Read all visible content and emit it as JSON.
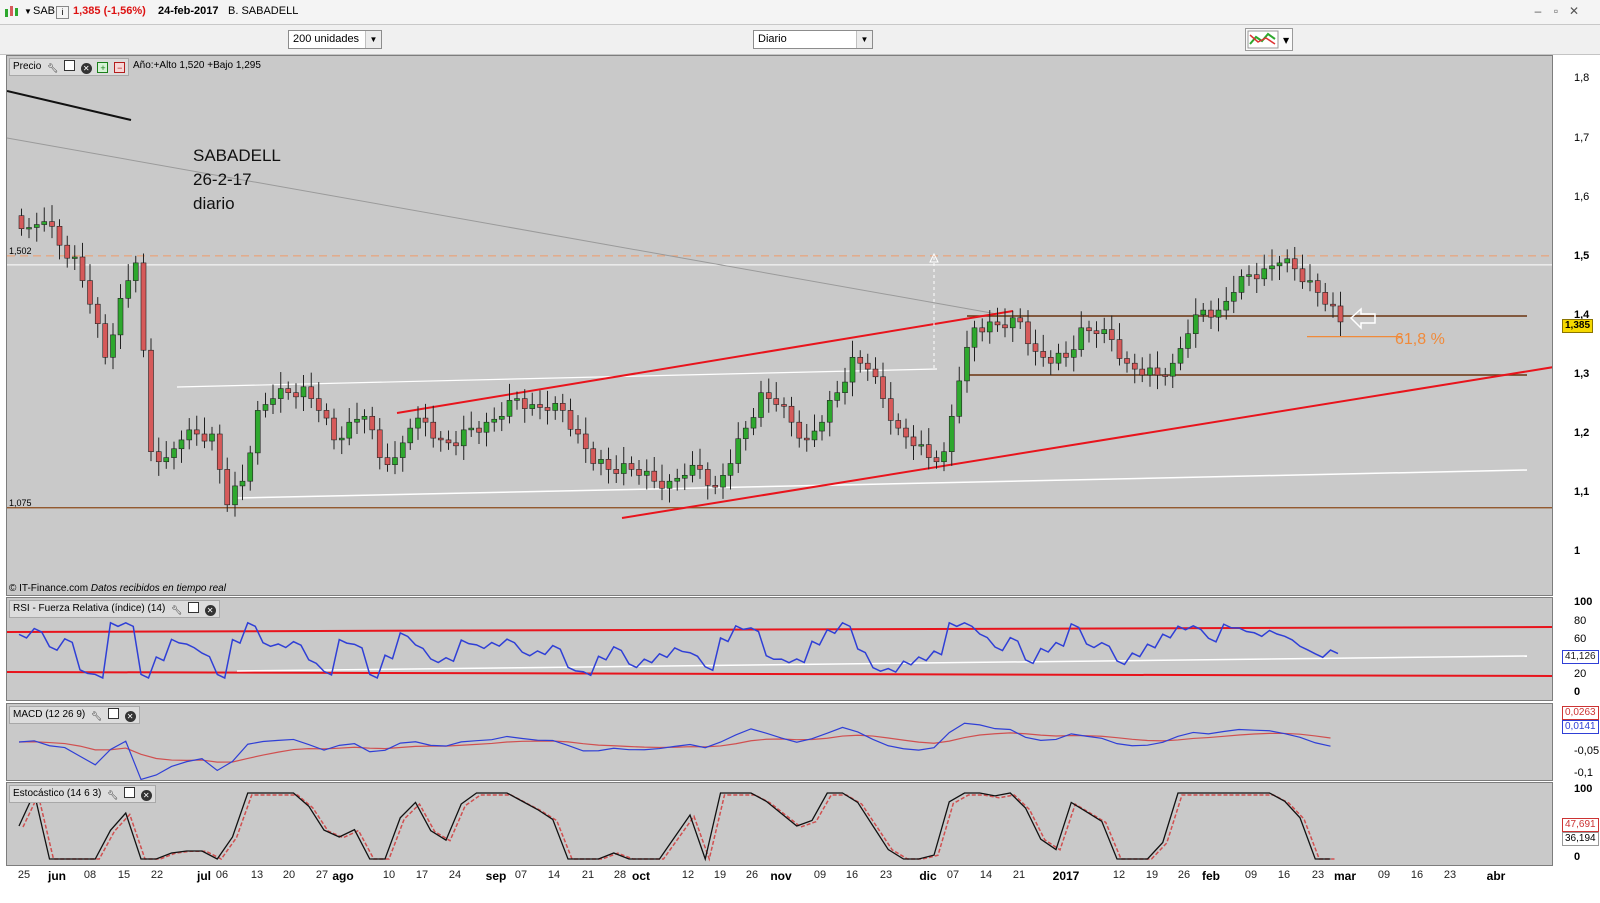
{
  "titlebar": {
    "symbol": "SAB",
    "price_change": "1,385 (-1,56%)",
    "date": "24-feb-2017",
    "name": "B. SABADELL"
  },
  "toolbar": {
    "units_select": "200 unidades",
    "period_select": "Diario"
  },
  "price_panel": {
    "header": "Precio",
    "year_info": "Año:+Alto 1,520 +Bajo 1,295",
    "notes": [
      "SABADELL",
      "26-2-17",
      "diario"
    ],
    "ref_high": "1,502",
    "ref_low": "1,075",
    "fib_label": "61,8 %",
    "current_price": "1,385",
    "copyright": "© IT-Finance.com",
    "realtime": "Datos recibidos en tiempo real",
    "y_ticks": [
      "1,8",
      "1,7",
      "1,6",
      "1,5",
      "1,4",
      "1,3",
      "1,2",
      "1,1",
      "1"
    ]
  },
  "rsi_panel": {
    "header": "RSI - Fuerza Relativa (índice) (14)",
    "value": "41,126",
    "y_ticks": [
      "100",
      "80",
      "60",
      "40",
      "20",
      "0"
    ]
  },
  "macd_panel": {
    "header": "MACD (12 26 9)",
    "value_signal": "0,0263",
    "value_macd": "0,0141",
    "y_ticks": [
      "-0,05",
      "-0,1"
    ]
  },
  "stoch_panel": {
    "header": "Estocástico (14 6 3)",
    "value_d": "47,691",
    "value_k": "36,194",
    "y_ticks": [
      "100",
      "0"
    ]
  },
  "x_axis": [
    {
      "label": "25",
      "bold": false
    },
    {
      "label": "jun",
      "bold": true
    },
    {
      "label": "08",
      "bold": false
    },
    {
      "label": "15",
      "bold": false
    },
    {
      "label": "22",
      "bold": false
    },
    {
      "label": "jul",
      "bold": true
    },
    {
      "label": "06",
      "bold": false
    },
    {
      "label": "13",
      "bold": false
    },
    {
      "label": "20",
      "bold": false
    },
    {
      "label": "27",
      "bold": false
    },
    {
      "label": "ago",
      "bold": true
    },
    {
      "label": "10",
      "bold": false
    },
    {
      "label": "17",
      "bold": false
    },
    {
      "label": "24",
      "bold": false
    },
    {
      "label": "sep",
      "bold": true
    },
    {
      "label": "07",
      "bold": false
    },
    {
      "label": "14",
      "bold": false
    },
    {
      "label": "21",
      "bold": false
    },
    {
      "label": "28",
      "bold": false
    },
    {
      "label": "oct",
      "bold": true
    },
    {
      "label": "12",
      "bold": false
    },
    {
      "label": "19",
      "bold": false
    },
    {
      "label": "26",
      "bold": false
    },
    {
      "label": "nov",
      "bold": true
    },
    {
      "label": "09",
      "bold": false
    },
    {
      "label": "16",
      "bold": false
    },
    {
      "label": "23",
      "bold": false
    },
    {
      "label": "dic",
      "bold": true
    },
    {
      "label": "07",
      "bold": false
    },
    {
      "label": "14",
      "bold": false
    },
    {
      "label": "21",
      "bold": false
    },
    {
      "label": "2017",
      "bold": true
    },
    {
      "label": "12",
      "bold": false
    },
    {
      "label": "19",
      "bold": false
    },
    {
      "label": "26",
      "bold": false
    },
    {
      "label": "feb",
      "bold": true
    },
    {
      "label": "09",
      "bold": false
    },
    {
      "label": "16",
      "bold": false
    },
    {
      "label": "23",
      "bold": false
    },
    {
      "label": "mar",
      "bold": true
    },
    {
      "label": "09",
      "bold": false
    },
    {
      "label": "16",
      "bold": false
    },
    {
      "label": "23",
      "bold": false
    },
    {
      "label": "abr",
      "bold": true
    }
  ],
  "colors": {
    "panel_bg": "#c9c9c9",
    "bull": "#2ea82e",
    "bear": "#d65a5a",
    "trendline": "#e8141c",
    "fib": "#f08a3a",
    "rsi": "#2f3fd6",
    "signal": "#d05050"
  },
  "chart_data": {
    "type": "candlestick",
    "series": [
      {
        "name": "Precio",
        "close": [
          1.55,
          1.56,
          1.52,
          1.5,
          1.42,
          1.33,
          1.43,
          1.49,
          1.17,
          1.16,
          1.19,
          1.2,
          1.2,
          1.08,
          1.12,
          1.24,
          1.26,
          1.27,
          1.28,
          1.24,
          1.19,
          1.22,
          1.23,
          1.16,
          1.16,
          1.21,
          1.22,
          1.19,
          1.18,
          1.21,
          1.22,
          1.23,
          1.26,
          1.25,
          1.24,
          1.24,
          1.2,
          1.15,
          1.14,
          1.15,
          1.13,
          1.12,
          1.12,
          1.13,
          1.14,
          1.11,
          1.15,
          1.21,
          1.27,
          1.25,
          1.22,
          1.19,
          1.22,
          1.27,
          1.33,
          1.31,
          1.26,
          1.21,
          1.18,
          1.16,
          1.17,
          1.29,
          1.38,
          1.39,
          1.38,
          1.39,
          1.34,
          1.32,
          1.33,
          1.38,
          1.37,
          1.36,
          1.32,
          1.3,
          1.3,
          1.32,
          1.37,
          1.41,
          1.41,
          1.44,
          1.47,
          1.48,
          1.49,
          1.48,
          1.46,
          1.42,
          1.39
        ]
      }
    ],
    "y_ticks": [
      "1",
      "1,1",
      "1,2",
      "1,3",
      "1,4",
      "1,5",
      "1,6",
      "1,7",
      "1,8"
    ]
  }
}
